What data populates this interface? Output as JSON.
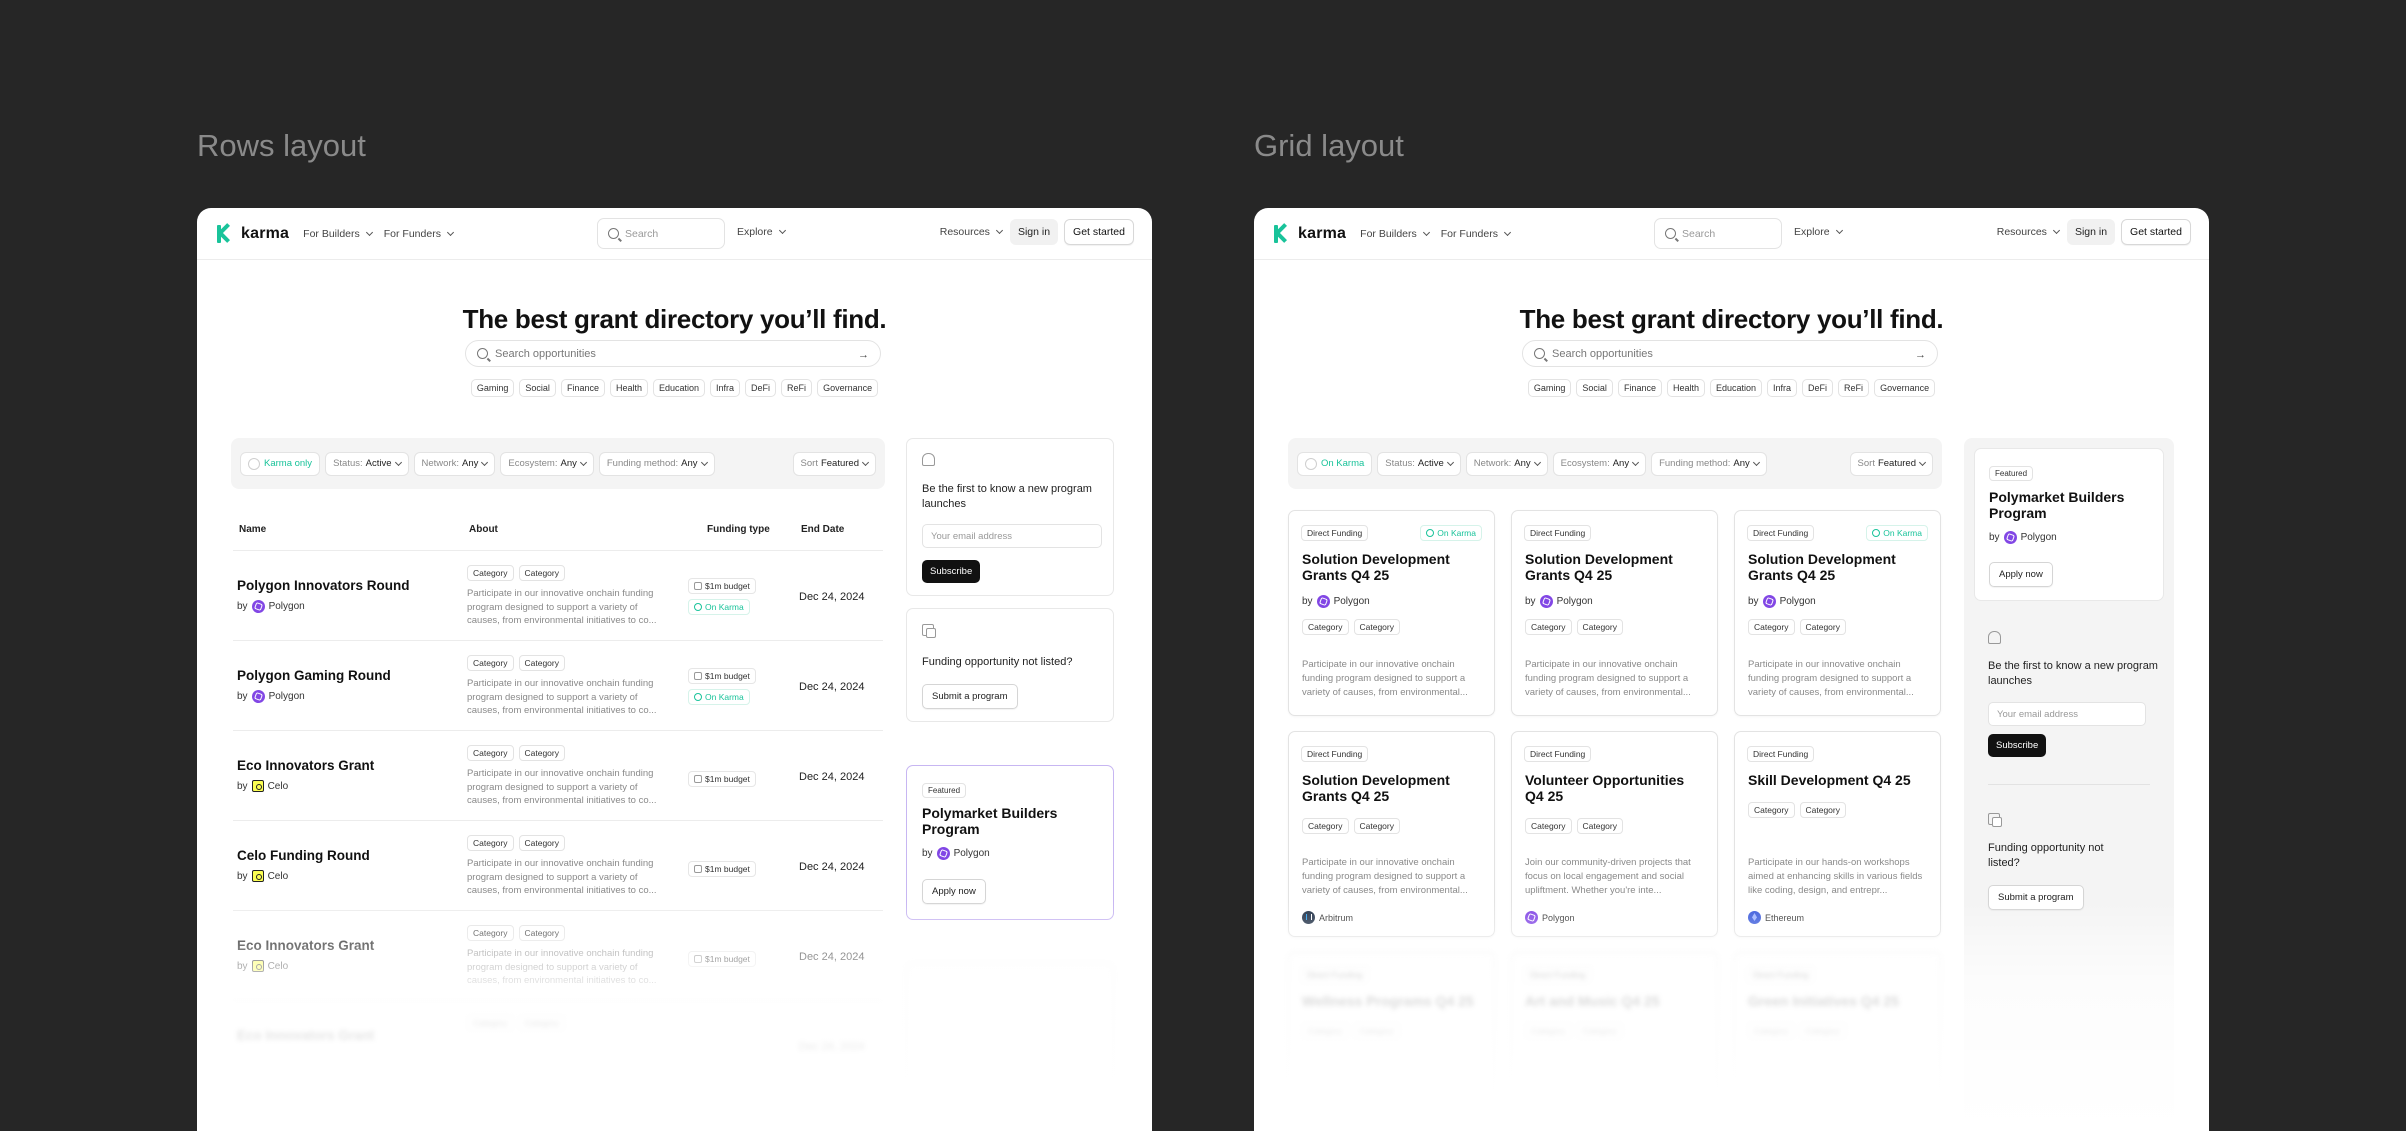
{
  "left_title": "Rows layout",
  "right_title": "Grid layout",
  "nav": {
    "logo": "karma",
    "for_builders": "For Builders",
    "for_funders": "For Funders",
    "search_placeholder": "Search",
    "explore": "Explore",
    "resources": "Resources",
    "sign_in": "Sign in",
    "get_started": "Get started"
  },
  "hero": {
    "title": "The best grant directory you’ll find.",
    "search_placeholder": "Search opportunities",
    "chips": [
      "Gaming",
      "Social",
      "Finance",
      "Health",
      "Education",
      "Infra",
      "DeFi",
      "ReFi",
      "Governance"
    ]
  },
  "filters": {
    "karma_only": "Karma only",
    "on_karma": "On Karma",
    "status_label": "Status:",
    "status_value": "Active",
    "network_label": "Network:",
    "network_value": "Any",
    "ecosystem_label": "Ecosystem:",
    "ecosystem_value": "Any",
    "funding_label": "Funding method:",
    "funding_value": "Any",
    "sort_label": "Sort",
    "sort_value": "Featured"
  },
  "table": {
    "headers": {
      "name": "Name",
      "about": "About",
      "funding": "Funding type",
      "end": "End Date"
    },
    "rows": [
      {
        "name": "Polygon Innovators Round",
        "by": "by",
        "org": "Polygon",
        "cat1": "Category",
        "cat2": "Category",
        "about": "Participate in our innovative onchain funding program designed to support a variety of causes, from environmental initiatives to co...",
        "budget": "$1m budget",
        "karma": "On Karma",
        "date": "Dec 24, 2024"
      },
      {
        "name": "Polygon Gaming Round",
        "by": "by",
        "org": "Polygon",
        "cat1": "Category",
        "cat2": "Category",
        "about": "Participate in our innovative onchain funding program designed to support a variety of causes, from environmental initiatives to co...",
        "budget": "$1m budget",
        "karma": "On Karma",
        "date": "Dec 24, 2024"
      },
      {
        "name": "Eco Innovators Grant",
        "by": "by",
        "org": "Celo",
        "cat1": "Category",
        "cat2": "Category",
        "about": "Participate in our innovative onchain funding program designed to support a variety of causes, from environmental initiatives to co...",
        "budget": "$1m budget",
        "date": "Dec 24, 2024"
      },
      {
        "name": "Celo Funding Round",
        "by": "by",
        "org": "Celo",
        "cat1": "Category",
        "cat2": "Category",
        "about": "Participate in our innovative onchain funding program designed to support a variety of causes, from environmental initiatives to co...",
        "budget": "$1m budget",
        "date": "Dec 24, 2024"
      },
      {
        "name": "Eco Innovators Grant",
        "by": "by",
        "org": "Celo",
        "cat1": "Category",
        "cat2": "Category",
        "about": "Participate in our innovative onchain funding program designed to support a variety of causes, from environmental initiatives to co...",
        "budget": "$1m budget",
        "date": "Dec 24, 2024"
      }
    ]
  },
  "sidebar": {
    "notify_text": "Be the first to know a new program launches",
    "email_placeholder": "Your email address",
    "subscribe": "Subscribe",
    "not_listed": "Funding opportunity not listed?",
    "submit": "Submit a program",
    "featured_badge": "Featured",
    "featured_title": "Polymarket Builders Program",
    "featured_by": "by",
    "featured_org": "Polygon",
    "apply": "Apply now"
  },
  "grid": {
    "cards": [
      {
        "type": "Direct Funding",
        "karma": "On Karma",
        "title": "Solution Development Grants Q4 25",
        "by": "by",
        "org": "Polygon",
        "cat1": "Category",
        "cat2": "Category",
        "about": "Participate in our innovative onchain funding program designed to support a variety of causes, from environmental..."
      },
      {
        "type": "Direct Funding",
        "title": "Solution Development Grants Q4 25",
        "by": "by",
        "org": "Polygon",
        "cat1": "Category",
        "cat2": "Category",
        "about": "Participate in our innovative onchain funding program designed to support a variety of causes, from environmental..."
      },
      {
        "type": "Direct Funding",
        "karma": "On Karma",
        "title": "Solution Development Grants Q4 25",
        "by": "by",
        "org": "Polygon",
        "cat1": "Category",
        "cat2": "Category",
        "about": "Participate in our innovative onchain funding program designed to support a variety of causes, from environmental..."
      },
      {
        "type": "Direct Funding",
        "title": "Solution Development Grants Q4 25",
        "cat1": "Category",
        "cat2": "Category",
        "about": "Participate in our innovative onchain funding program designed to support a variety of causes, from environmental...",
        "foot": "Arbitrum"
      },
      {
        "type": "Direct Funding",
        "title": "Volunteer Opportunities Q4 25",
        "cat1": "Category",
        "cat2": "Category",
        "about": "Join our community-driven projects that focus on local engagement and social upliftment. Whether you're inte...",
        "foot": "Polygon"
      },
      {
        "type": "Direct Funding",
        "title": "Skill Development Q4 25",
        "cat1": "Category",
        "cat2": "Category",
        "about": "Participate in our hands-on workshops aimed at enhancing skills in various fields like coding, design, and entrepr...",
        "foot": "Ethereum"
      },
      {
        "type": "Direct Funding",
        "title": "Wellness Programs Q4 25",
        "cat1": "Category",
        "cat2": "Category"
      },
      {
        "type": "Direct Funding",
        "title": "Art and Music Q4 25",
        "cat1": "Category",
        "cat2": "Category"
      },
      {
        "type": "Direct Funding",
        "title": "Green Initiatives Q4 25",
        "cat1": "Category",
        "cat2": "Category"
      }
    ]
  }
}
